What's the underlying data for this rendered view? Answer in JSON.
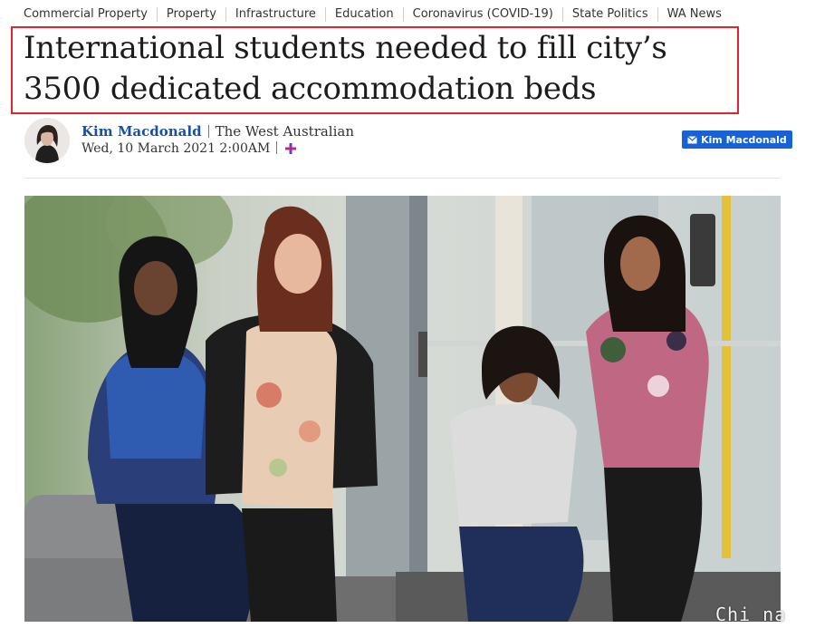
{
  "tags": [
    {
      "label": "Commercial Property"
    },
    {
      "label": "Property"
    },
    {
      "label": "Infrastructure"
    },
    {
      "label": "Education"
    },
    {
      "label": "Coronavirus (COVID-19)"
    },
    {
      "label": "State Politics"
    },
    {
      "label": "WA News"
    }
  ],
  "article": {
    "headline_line1": "International students needed to fill city’s",
    "headline_line2": "3500 dedicated accommodation beds"
  },
  "byline": {
    "author": "Kim Macdonald",
    "publication": "The West Australian",
    "date": "Wed, 10 March 2021 2:00AM",
    "follow_label": "Kim Macdonald"
  },
  "photo": {
    "watermark": "Chi na"
  },
  "colors": {
    "highlight": "#e0252b",
    "author_link": "#1b4fa3",
    "follow_button": "#1762d6",
    "plus_icon": "#8a2be2"
  },
  "icons": {
    "follow": "mail-icon",
    "premium": "plus-icon"
  }
}
